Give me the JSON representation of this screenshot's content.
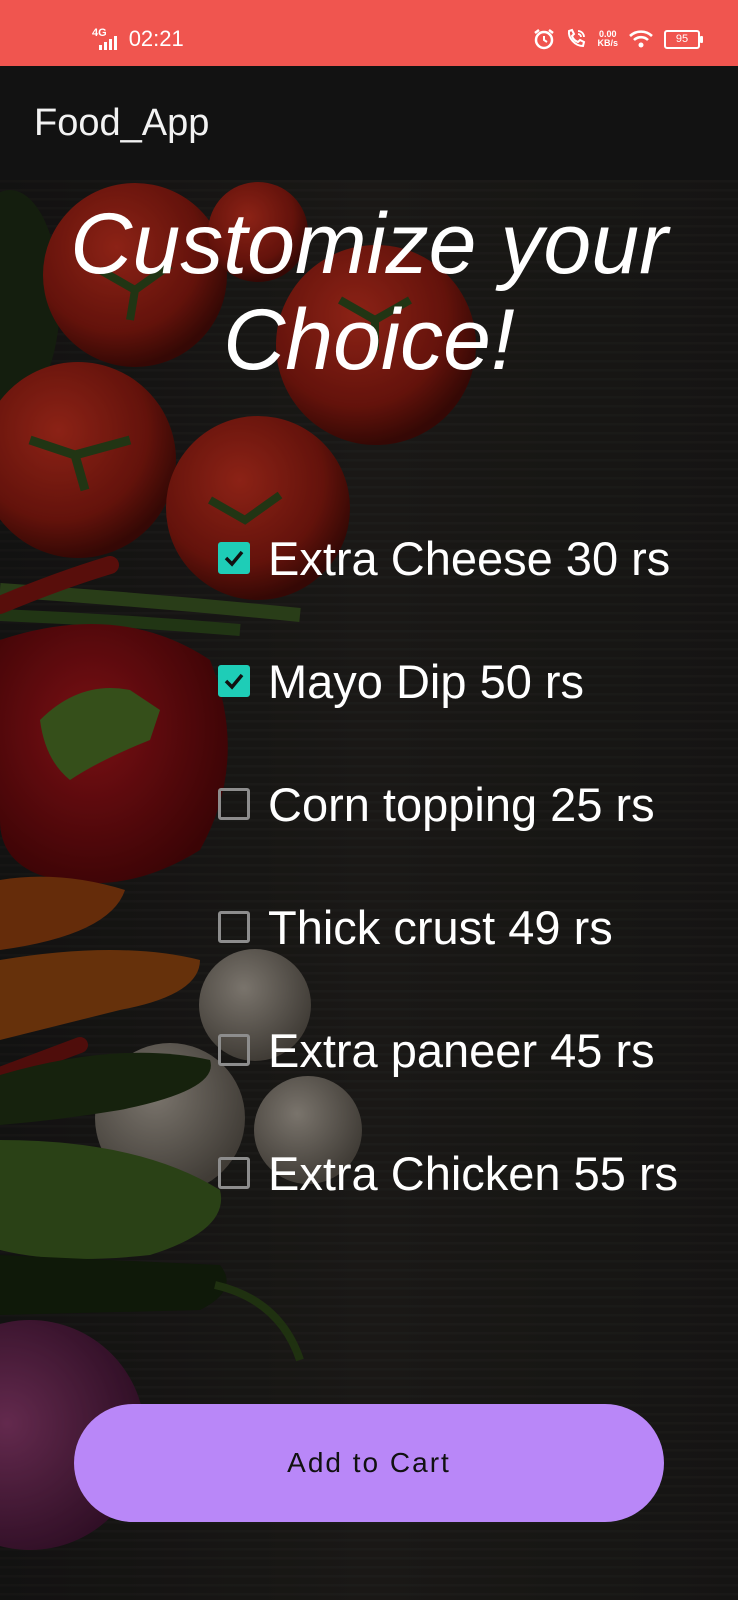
{
  "status_bar": {
    "network": "4G",
    "time": "02:21",
    "speed_value": "0.00",
    "speed_unit": "KB/s",
    "battery": "95",
    "icons": [
      "signal-icon",
      "alarm-icon",
      "call-icon",
      "wifi-icon",
      "battery-icon"
    ]
  },
  "app_bar": {
    "title": "Food_App"
  },
  "headline": "Customize your Choice!",
  "options": [
    {
      "label": "Extra Cheese   30 rs",
      "checked": true
    },
    {
      "label": "Mayo Dip 50 rs",
      "checked": true
    },
    {
      "label": "Corn topping 25 rs",
      "checked": false
    },
    {
      "label": "Thick crust  49 rs",
      "checked": false
    },
    {
      "label": "Extra paneer  45 rs",
      "checked": false
    },
    {
      "label": "Extra Chicken 55 rs",
      "checked": false
    }
  ],
  "button": {
    "label": "Add to Cart"
  },
  "colors": {
    "status_bar": "#f0554f",
    "app_bar": "#121212",
    "checkbox_checked": "#1ecdb7",
    "button": "#b987f8"
  }
}
